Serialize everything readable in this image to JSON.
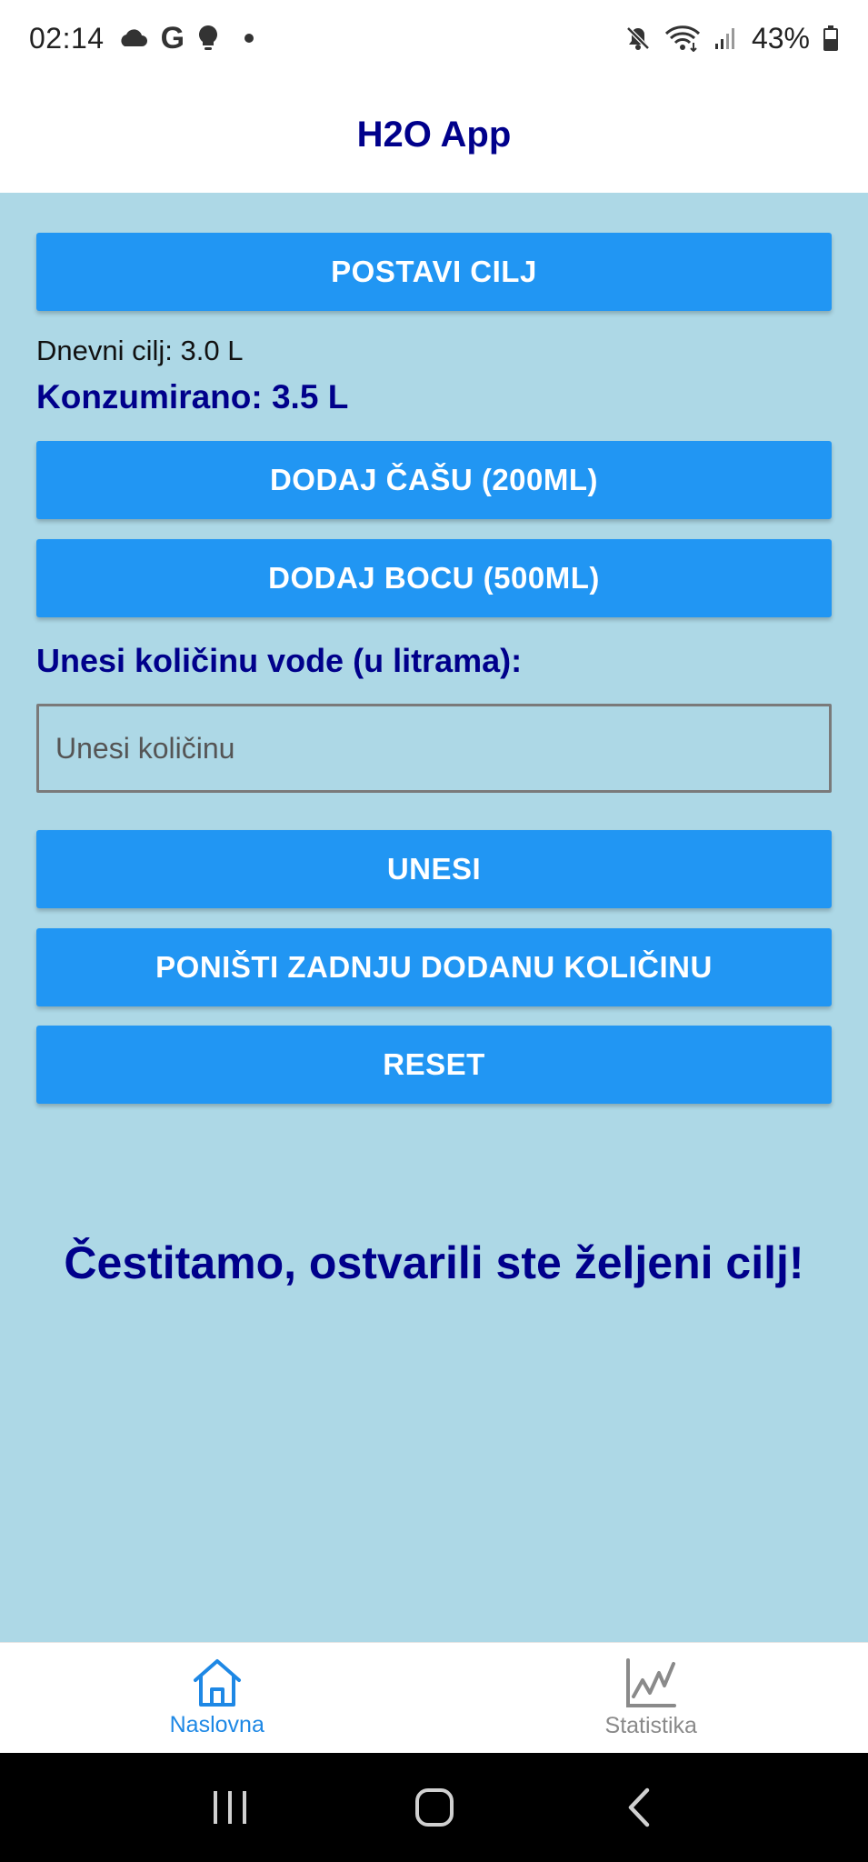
{
  "status_bar": {
    "time": "02:14",
    "battery": "43%",
    "icons": [
      "cloud-icon",
      "google-icon",
      "lightbulb-icon",
      "notification-dot-icon",
      "mute-icon",
      "wifi-icon",
      "signal-icon",
      "battery-icon"
    ]
  },
  "header": {
    "title": "H2O App"
  },
  "main": {
    "set_goal_button": "POSTAVI CILJ",
    "daily_goal": "Dnevni cilj: 3.0 L",
    "consumed": "Konzumirano: 3.5 L",
    "add_glass_button": "DODAJ ČAŠU (200ML)",
    "add_bottle_button": "DODAJ BOCU (500ML)",
    "input_label": "Unesi količinu vode (u litrama):",
    "input_placeholder": "Unesi količinu",
    "input_value": "",
    "submit_button": "UNESI",
    "undo_button": "PONIŠTI ZADNJU DODANU KOLIČINU",
    "reset_button": "RESET",
    "congrats_message": "Čestitamo, ostvarili ste željeni cilj!"
  },
  "bottom_nav": {
    "items": [
      {
        "label": "Naslovna",
        "icon": "home-icon",
        "active": true
      },
      {
        "label": "Statistika",
        "icon": "chart-icon",
        "active": false
      }
    ]
  },
  "colors": {
    "accent": "#2196f3",
    "background": "#add8e6",
    "heading": "#00008b",
    "nav_active": "#1e88e5",
    "nav_inactive": "#8a8a8a"
  }
}
